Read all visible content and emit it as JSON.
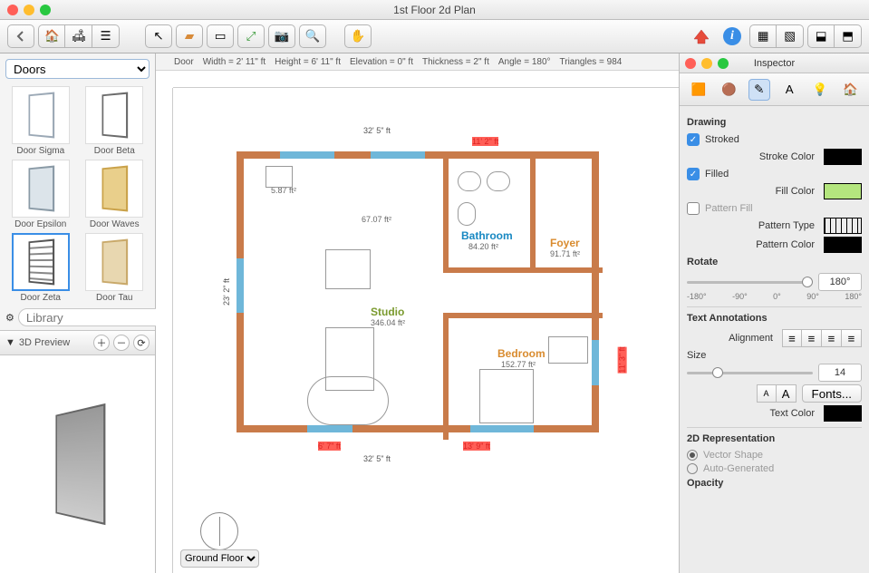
{
  "window": {
    "title": "1st Floor 2d Plan"
  },
  "library": {
    "category": "Doors",
    "items": [
      {
        "label": "Door Sigma"
      },
      {
        "label": "Door Beta"
      },
      {
        "label": "Door Epsilon"
      },
      {
        "label": "Door Waves"
      },
      {
        "label": "Door Zeta",
        "selected": true
      },
      {
        "label": "Door Tau"
      }
    ],
    "search_placeholder": "Library",
    "preview_title": "3D Preview"
  },
  "status": {
    "object": "Door",
    "width": "Width = 2' 11\" ft",
    "height": "Height = 6' 11\" ft",
    "elevation": "Elevation = 0\" ft",
    "thickness": "Thickness = 2\" ft",
    "angle": "Angle = 180°",
    "triangles": "Triangles = 984"
  },
  "plan": {
    "floor_selector": "Ground Floor",
    "dims": {
      "top_total": "32' 5\" ft",
      "top_right": "11' 2\" ft",
      "left_total": "23' 2\" ft",
      "right_total": "11' 3\" ft",
      "bottom_total": "32' 5\" ft",
      "bottom_left": "6' 7\" ft",
      "bottom_right": "13' 9\" ft",
      "studio_note": "5.87 ft²",
      "kitchen_area": "67.07 ft²"
    },
    "rooms": {
      "bathroom": {
        "label": "Bathroom",
        "area": "84.20 ft²"
      },
      "foyer": {
        "label": "Foyer",
        "area": "91.71 ft²"
      },
      "studio": {
        "label": "Studio",
        "area": "346.04 ft²"
      },
      "bedroom": {
        "label": "Bedroom",
        "area": "152.77 ft²"
      }
    }
  },
  "inspector": {
    "title": "Inspector",
    "drawing": {
      "section": "Drawing",
      "stroked_label": "Stroked",
      "stroke_color_label": "Stroke Color",
      "filled_label": "Filled",
      "fill_color_label": "Fill Color",
      "pattern_fill_label": "Pattern Fill",
      "pattern_type_label": "Pattern Type",
      "pattern_color_label": "Pattern Color"
    },
    "rotate": {
      "section": "Rotate",
      "value": "180°",
      "ticks": [
        "-180°",
        "-90°",
        "0°",
        "90°",
        "180°"
      ]
    },
    "text": {
      "section": "Text Annotations",
      "alignment_label": "Alignment",
      "size_label": "Size",
      "size_value": "14",
      "fonts_label": "Fonts...",
      "text_color_label": "Text Color"
    },
    "rep": {
      "section": "2D Representation",
      "vector_label": "Vector Shape",
      "auto_label": "Auto-Generated"
    },
    "opacity": {
      "section": "Opacity"
    }
  }
}
